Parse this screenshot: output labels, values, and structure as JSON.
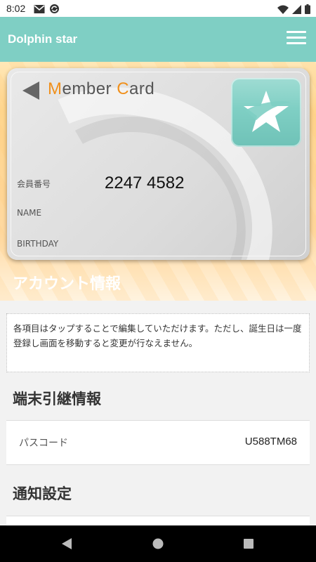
{
  "status": {
    "time": "8:02",
    "left_icons": [
      "gmail-icon",
      "sync-icon"
    ],
    "right_icons": [
      "wifi-icon",
      "signal-icon",
      "battery-icon"
    ]
  },
  "app_bar": {
    "title": "Dolphin star",
    "menu_icon": "hamburger-menu-icon"
  },
  "card": {
    "title_prefix_1": "M",
    "title_part_1": "ember ",
    "title_prefix_2": "C",
    "title_part_2": "ard",
    "member_no_label": "会員番号",
    "member_no": "2247 4582",
    "name_label": "NAME",
    "birthday_label": "BIRTHDAY",
    "accent_color": "#f0901c",
    "logo_color": "#7fcfc4"
  },
  "account": {
    "heading": "アカウント情報",
    "notice": "各項目はタップすることで編集していただけます。ただし、誕生日は一度登録し画面を移動すると変更が行なえません。"
  },
  "device_transfer": {
    "heading": "端末引継情報",
    "passcode_label": "パスコード",
    "passcode_value": "U588TM68"
  },
  "notifications": {
    "heading": "通知設定"
  },
  "nav": {
    "back_icon": "back-icon",
    "home_icon": "home-icon",
    "recents_icon": "recents-icon"
  }
}
